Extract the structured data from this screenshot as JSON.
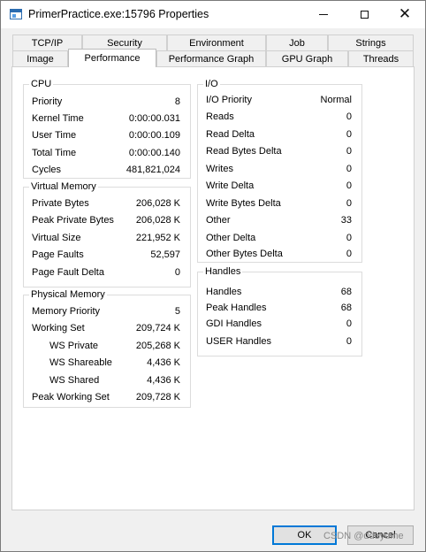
{
  "window": {
    "title": "PrimerPractice.exe:15796 Properties"
  },
  "tabs": {
    "back_row": [
      "TCP/IP",
      "Security",
      "Environment",
      "Job",
      "Strings"
    ],
    "front_row": [
      "Image",
      "Performance",
      "Performance Graph",
      "GPU Graph",
      "Threads"
    ],
    "active": "Performance"
  },
  "cpu": {
    "title": "CPU",
    "rows": [
      {
        "label": "Priority",
        "value": "8"
      },
      {
        "label": "Kernel Time",
        "value": "0:00:00.031"
      },
      {
        "label": "User Time",
        "value": "0:00:00.109"
      },
      {
        "label": "Total Time",
        "value": "0:00:00.140"
      },
      {
        "label": "Cycles",
        "value": "481,821,024"
      }
    ]
  },
  "virtual_memory": {
    "title": "Virtual Memory",
    "rows": [
      {
        "label": "Private Bytes",
        "value": "206,028 K"
      },
      {
        "label": "Peak Private Bytes",
        "value": "206,028 K"
      },
      {
        "label": "Virtual Size",
        "value": "221,952 K"
      },
      {
        "label": "Page Faults",
        "value": "52,597"
      },
      {
        "label": "Page Fault Delta",
        "value": "0"
      }
    ]
  },
  "physical_memory": {
    "title": "Physical Memory",
    "rows": [
      {
        "label": "Memory Priority",
        "value": "5"
      },
      {
        "label": "Working Set",
        "value": "209,724 K"
      },
      {
        "label": "WS Private",
        "value": "205,268 K"
      },
      {
        "label": "WS Shareable",
        "value": "4,436 K"
      },
      {
        "label": "WS Shared",
        "value": "4,436 K"
      },
      {
        "label": "Peak Working Set",
        "value": "209,728 K"
      }
    ]
  },
  "io": {
    "title": "I/O",
    "rows": [
      {
        "label": "I/O Priority",
        "value": "Normal"
      },
      {
        "label": "Reads",
        "value": "0"
      },
      {
        "label": "Read Delta",
        "value": "0"
      },
      {
        "label": "Read Bytes Delta",
        "value": "0"
      },
      {
        "label": "Writes",
        "value": "0"
      },
      {
        "label": "Write Delta",
        "value": "0"
      },
      {
        "label": "Write Bytes Delta",
        "value": "0"
      },
      {
        "label": "Other",
        "value": "33"
      },
      {
        "label": "Other Delta",
        "value": "0"
      },
      {
        "label": "Other Bytes Delta",
        "value": "0"
      }
    ]
  },
  "handles": {
    "title": "Handles",
    "rows": [
      {
        "label": "Handles",
        "value": "68"
      },
      {
        "label": "Peak Handles",
        "value": "68"
      },
      {
        "label": "GDI Handles",
        "value": "0"
      },
      {
        "label": "USER Handles",
        "value": "0"
      }
    ]
  },
  "buttons": {
    "ok": "OK",
    "cancel": "Cancel"
  },
  "watermark": "CSDN @ddeyume",
  "colors": {
    "accent": "#0078d7",
    "panel_bg": "#ffffff",
    "dialog_bg": "#f0f0f0"
  }
}
